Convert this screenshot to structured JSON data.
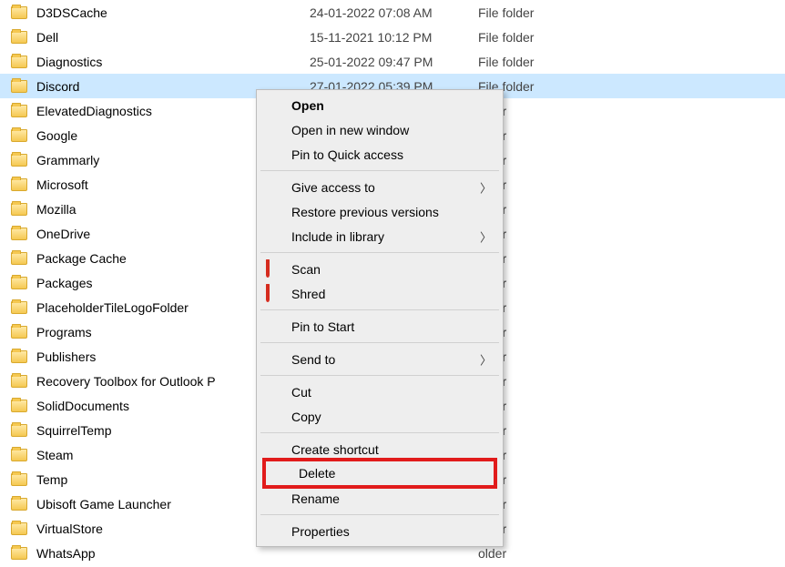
{
  "type_label": "File folder",
  "rows": [
    {
      "name": "D3DSCache",
      "date": "24-01-2022 07:08 AM",
      "selected": false
    },
    {
      "name": "Dell",
      "date": "15-11-2021 10:12 PM",
      "selected": false
    },
    {
      "name": "Diagnostics",
      "date": "25-01-2022 09:47 PM",
      "selected": false
    },
    {
      "name": "Discord",
      "date": "27-01-2022 05:39 PM",
      "selected": true
    },
    {
      "name": "ElevatedDiagnostics",
      "date": "",
      "selected": false
    },
    {
      "name": "Google",
      "date": "",
      "selected": false
    },
    {
      "name": "Grammarly",
      "date": "",
      "selected": false
    },
    {
      "name": "Microsoft",
      "date": "",
      "selected": false
    },
    {
      "name": "Mozilla",
      "date": "",
      "selected": false
    },
    {
      "name": "OneDrive",
      "date": "",
      "selected": false
    },
    {
      "name": "Package Cache",
      "date": "",
      "selected": false
    },
    {
      "name": "Packages",
      "date": "",
      "selected": false
    },
    {
      "name": "PlaceholderTileLogoFolder",
      "date": "",
      "selected": false
    },
    {
      "name": "Programs",
      "date": "",
      "selected": false
    },
    {
      "name": "Publishers",
      "date": "",
      "selected": false
    },
    {
      "name": "Recovery Toolbox for Outlook P",
      "date": "",
      "selected": false
    },
    {
      "name": "SolidDocuments",
      "date": "",
      "selected": false
    },
    {
      "name": "SquirrelTemp",
      "date": "",
      "selected": false
    },
    {
      "name": "Steam",
      "date": "",
      "selected": false
    },
    {
      "name": "Temp",
      "date": "",
      "selected": false
    },
    {
      "name": "Ubisoft Game Launcher",
      "date": "",
      "selected": false
    },
    {
      "name": "VirtualStore",
      "date": "",
      "selected": false
    },
    {
      "name": "WhatsApp",
      "date": "",
      "selected": false
    }
  ],
  "obscured_type": "older",
  "ctx": {
    "open": "Open",
    "open_new_window": "Open in new window",
    "pin_quick": "Pin to Quick access",
    "give_access": "Give access to",
    "restore_prev": "Restore previous versions",
    "include_lib": "Include in library",
    "scan": "Scan",
    "shred": "Shred",
    "pin_start": "Pin to Start",
    "send_to": "Send to",
    "cut": "Cut",
    "copy": "Copy",
    "create_shortcut": "Create shortcut",
    "delete": "Delete",
    "rename": "Rename",
    "properties": "Properties"
  }
}
